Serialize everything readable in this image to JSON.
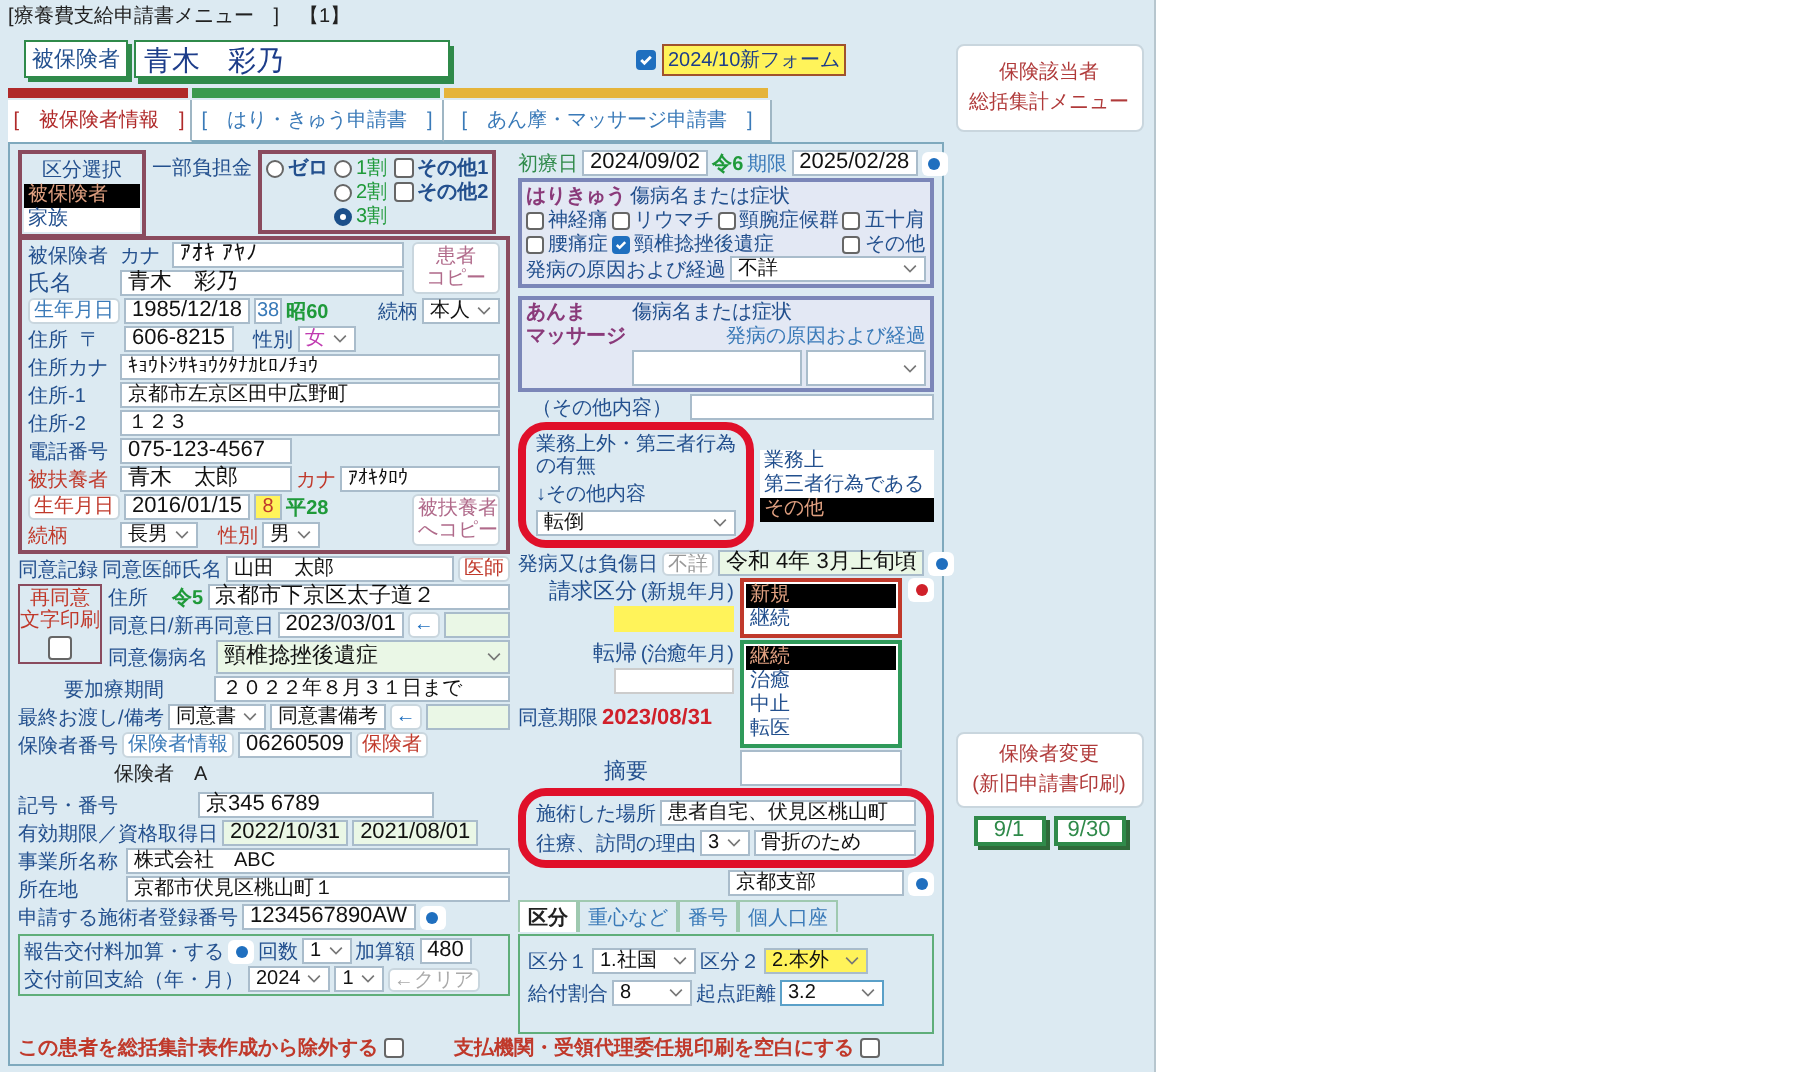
{
  "title": "[療養費支給申請書メニュー　]　【1】",
  "insured_header": {
    "label": "被保険者",
    "name": "青木　彩乃"
  },
  "new_form": {
    "checked": true,
    "label": "2024/10新フォーム"
  },
  "summary_button": {
    "lines": [
      "保険該当者",
      "総括集計メニュー"
    ]
  },
  "tabs": [
    {
      "label": "[　被保険者情報　]",
      "selected": true,
      "color": "#b02a2a"
    },
    {
      "label": "[　はり・きゅう申請書　]",
      "selected": false,
      "color": "#3a9a4e"
    },
    {
      "label": "[　あん摩・マッサージ申請書　]",
      "selected": false,
      "color": "#e5b43a"
    }
  ],
  "category_select": {
    "title": "区分選択",
    "options": [
      {
        "label": "被保険者",
        "selected": true
      },
      {
        "label": "家族",
        "selected": false
      }
    ]
  },
  "copay": {
    "label": "一部負担金",
    "radios": [
      {
        "label": "ゼロ",
        "selected": false
      },
      {
        "label": "1割",
        "selected": false
      },
      {
        "label": "2割",
        "selected": false
      },
      {
        "label": "3割",
        "selected": true
      }
    ],
    "checkboxes": [
      {
        "label": "その他1",
        "checked": false
      },
      {
        "label": "その他2",
        "checked": false
      }
    ]
  },
  "insured": {
    "label": "被保険者",
    "kana_caption": "カナ",
    "kana": "ｱｵｷ ｱﾔﾉ",
    "copy_button": {
      "lines": [
        "患者",
        "コピー"
      ]
    },
    "name_label": "氏名",
    "name": "青木　彩乃",
    "birth_button": "生年月日",
    "birth": "1985/12/18",
    "age": "38",
    "era": "昭60",
    "relation_label": "続柄",
    "relation": "本人",
    "addr_label": "住所",
    "zip_mark": "〒",
    "zip": "606-8215",
    "sex_label": "性別",
    "sex": "女",
    "addr_kana_label": "住所カナ",
    "addr_kana": "ｷｮｳﾄｼｻｷｮｳｸﾀﾅｶﾋﾛﾉﾁｮｳ",
    "addr1_label": "住所-1",
    "addr1": "京都市左京区田中広野町",
    "addr2_label": "住所-2",
    "addr2": "１２３",
    "phone_label": "電話番号",
    "phone": "075-123-4567"
  },
  "dependent": {
    "label": "被扶養者",
    "name": "青木　太郎",
    "kana_caption": "カナ",
    "kana": "ｱｵｷﾀﾛｳ",
    "birth_button": "生年月日",
    "birth": "2016/01/15",
    "age": "8",
    "era": "平28",
    "copy_button": {
      "lines": [
        "被扶養者",
        "へコピー"
      ]
    },
    "relation_label": "続柄",
    "relation": "長男",
    "sex_label": "性別",
    "sex": "男"
  },
  "consent": {
    "record_label": "同意記録",
    "doctor_label": "同意医師氏名",
    "doctor": "山田　太郎",
    "doctor_button": "医師",
    "reprint": {
      "lines": [
        "再同意",
        "文字印刷"
      ],
      "checked": false
    },
    "address_label": "住所",
    "era": "令5",
    "address": "京都市下京区太子道２",
    "date_label": "同意日/新再同意日",
    "date": "2023/03/01",
    "arrow": "←",
    "expiry_label": "同意期限",
    "expiry": "2023/08/31",
    "disease_label": "同意傷病名",
    "disease": "頸椎捻挫後遺症",
    "period_label": "要加療期間",
    "period": "２０２２年８月３１日まで"
  },
  "handover": {
    "label": "最終お渡し/備考",
    "value": "同意書",
    "note": "同意書備考",
    "arrow": "←"
  },
  "insurer": {
    "label": "保険者番号",
    "info_button": "保険者情報",
    "number": "06260509",
    "button": "保険者",
    "name": "保険者　A",
    "symbol_label": "記号・番号",
    "symbol": "京345 6789",
    "validity_label": "有効期限／資格取得日",
    "expiry": "2022/10/31",
    "acquired": "2021/08/01",
    "office_label": "事業所名称",
    "office": "株式会社　ABC",
    "location_label": "所在地",
    "location": "京都市伏見区桃山町１",
    "reg_label": "申請する施術者登録番号",
    "reg": "1234567890AW"
  },
  "report_fee": {
    "label": "報告交付料加算・する",
    "count_label": "回数",
    "count": "1",
    "amount_label": "加算額",
    "amount": "480",
    "prev_label": "交付前回支給（年・月）",
    "year": "2024",
    "month": "1",
    "clear_button": "←クリア"
  },
  "exclude": {
    "label": "この患者を総括集計表作成から除外する",
    "checked": false
  },
  "blank_print": {
    "label": "支払機関・受領代理委任規印刷を空白にする",
    "checked": false
  },
  "first_visit": {
    "label": "初療日",
    "date": "2024/09/02",
    "era": "令6",
    "limit_label": "期限",
    "limit": "2025/02/28"
  },
  "acupuncture": {
    "title": "はりきゅう",
    "subtitle": "傷病名または症状",
    "symptoms": [
      {
        "label": "神経痛",
        "checked": false
      },
      {
        "label": "リウマチ",
        "checked": false
      },
      {
        "label": "頸腕症候群",
        "checked": false
      },
      {
        "label": "五十肩",
        "checked": false
      },
      {
        "label": "腰痛症",
        "checked": false
      },
      {
        "label": "頸椎捻挫後遺症",
        "checked": true
      },
      {
        "label": "その他",
        "checked": false
      }
    ],
    "cause_label": "発病の原因および経過",
    "cause": "不詳"
  },
  "massage": {
    "title_lines": [
      "あんま",
      "マッサージ"
    ],
    "subtitle": "傷病名または症状",
    "cause_label": "発病の原因および経過"
  },
  "other_content_label": "（その他内容）",
  "work_related": {
    "title": "業務上外・第三者行為の有無",
    "sub": "↓その他内容",
    "value": "転倒",
    "options": [
      {
        "label": "業務上",
        "selected": false
      },
      {
        "label": "第三者行為である",
        "selected": false
      },
      {
        "label": "その他",
        "selected": true
      }
    ]
  },
  "onset": {
    "label": "発病又は負傷日",
    "unknown_button": "不詳",
    "value": "令和 4年 3月上旬頃"
  },
  "claim": {
    "label": "請求区分",
    "sub": "(新規年月)",
    "options": [
      {
        "label": "新規",
        "selected": true
      },
      {
        "label": "継続",
        "selected": false
      }
    ]
  },
  "outcome": {
    "label": "転帰",
    "sub": "(治癒年月)",
    "options": [
      {
        "label": "継続",
        "selected": true
      },
      {
        "label": "治癒",
        "selected": false
      },
      {
        "label": "中止",
        "selected": false
      },
      {
        "label": "転医",
        "selected": false
      }
    ]
  },
  "summary_label": "摘要",
  "visit": {
    "place_label": "施術した場所",
    "place": "患者自宅、伏見区桃山町",
    "reason_label": "往療、訪問の理由",
    "reason_code": "3",
    "reason": "骨折のため"
  },
  "branch": "京都支部",
  "detail_tabs": [
    {
      "label": "区分",
      "selected": true
    },
    {
      "label": "重心など",
      "selected": false
    },
    {
      "label": "番号",
      "selected": false
    },
    {
      "label": "個人口座",
      "selected": false
    }
  ],
  "detail": {
    "class1_label": "区分１",
    "class1": "1.社国",
    "class2_label": "区分２",
    "class2": "2.本外",
    "ratio_label": "給付割合",
    "ratio": "8",
    "distance_label": "起点距離",
    "distance": "3.2"
  },
  "change_button": {
    "lines": [
      "保険者変更",
      "(新旧申請書印刷)"
    ]
  },
  "date_buttons": [
    "9/1",
    "9/30"
  ]
}
